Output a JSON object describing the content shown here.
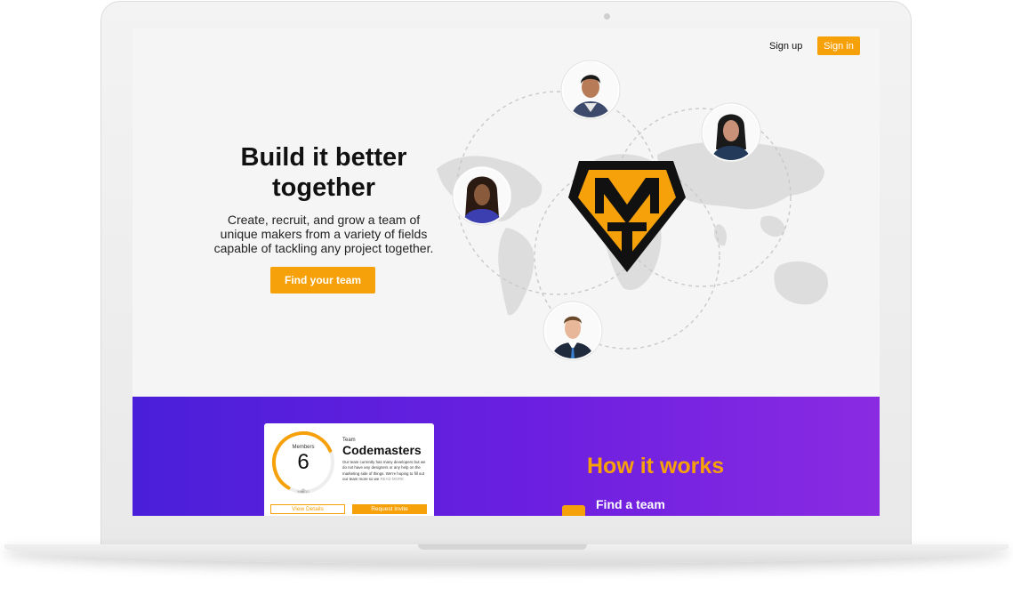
{
  "nav": {
    "signup_label": "Sign up",
    "signin_label": "Sign in"
  },
  "hero": {
    "title": "Build it better together",
    "subtitle": "Create, recruit, and grow a team of unique makers from a variety of fields capable of tackling any project together.",
    "cta_label": "Find your team"
  },
  "team_card": {
    "members_label": "Members",
    "members_count": "6",
    "max_label": "Max 10",
    "members_fraction": 0.6,
    "team_caption": "Team",
    "team_name": "Codemasters",
    "description": "Our team currently has many developers but we do not have any designers or any help on the marketing side of things. We're hoping to fill out our team more so we",
    "read_more": "READ MORE",
    "view_details_label": "View Details",
    "request_invite_label": "Request Invite"
  },
  "how_it_works": {
    "title": "How it works",
    "step1_title": "Find a team"
  },
  "colors": {
    "accent": "#f6a10a",
    "purple_start": "#4a1fd9",
    "purple_end": "#8a2be2",
    "logo_black": "#111111"
  },
  "icons": [
    "team-logo-icon",
    "avatar-icon",
    "world-map",
    "find-team-icon"
  ]
}
